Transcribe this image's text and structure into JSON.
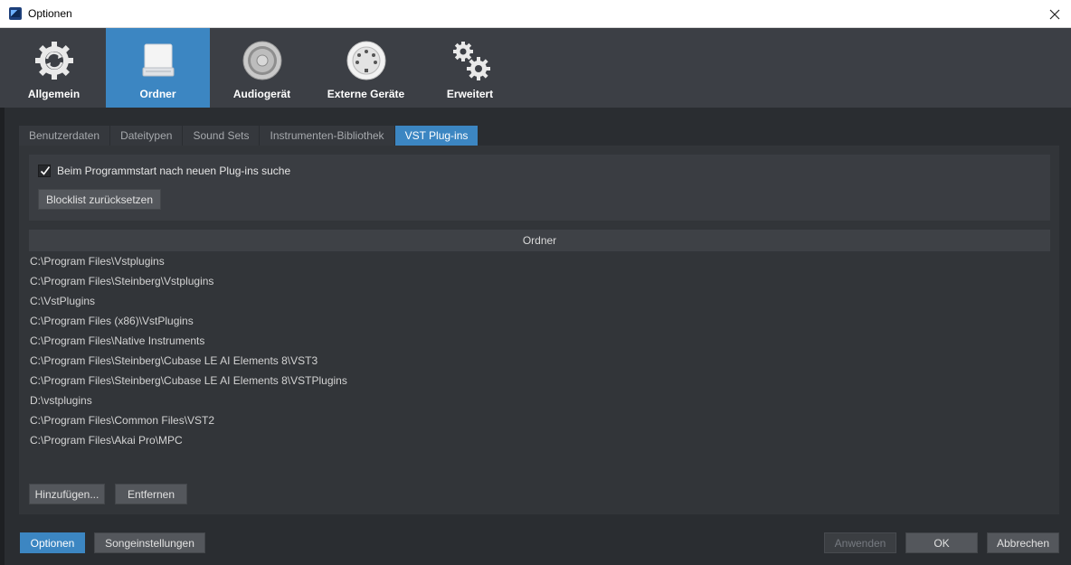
{
  "window": {
    "title": "Optionen"
  },
  "toolbar": {
    "items": [
      {
        "label": "Allgemein",
        "icon": "gear-refresh-icon"
      },
      {
        "label": "Ordner",
        "icon": "folder-drive-icon",
        "active": true
      },
      {
        "label": "Audiogerät",
        "icon": "speaker-icon"
      },
      {
        "label": "Externe Geräte",
        "icon": "midi-connector-icon"
      },
      {
        "label": "Erweitert",
        "icon": "gears-icon"
      }
    ]
  },
  "tabs": [
    {
      "label": "Benutzerdaten"
    },
    {
      "label": "Dateitypen"
    },
    {
      "label": "Sound Sets"
    },
    {
      "label": "Instrumenten-Bibliothek"
    },
    {
      "label": "VST Plug-ins",
      "active": true
    }
  ],
  "settings": {
    "scan_checkbox_label": "Beim Programmstart nach neuen Plug-ins suche",
    "scan_checked": true,
    "reset_blocklist_label": "Blocklist zurücksetzen"
  },
  "folders": {
    "header": "Ordner",
    "items": [
      "C:\\Program Files\\Vstplugins",
      "C:\\Program Files\\Steinberg\\Vstplugins",
      "C:\\VstPlugins",
      "C:\\Program Files (x86)\\VstPlugins",
      "C:\\Program Files\\Native Instruments",
      "C:\\Program Files\\Steinberg\\Cubase LE AI Elements 8\\VST3",
      "C:\\Program Files\\Steinberg\\Cubase LE AI Elements 8\\VSTPlugins",
      "D:\\vstplugins",
      "C:\\Program Files\\Common Files\\VST2",
      "C:\\Program Files\\Akai Pro\\MPC"
    ],
    "add_label": "Hinzufügen...",
    "remove_label": "Entfernen"
  },
  "footer": {
    "options_label": "Optionen",
    "song_settings_label": "Songeinstellungen",
    "apply_label": "Anwenden",
    "ok_label": "OK",
    "cancel_label": "Abbrechen"
  },
  "colors": {
    "accent": "#3c86c2",
    "toolbar_bg": "#3c3f45",
    "content_bg": "#2a2d31",
    "panel_bg": "#323539"
  }
}
